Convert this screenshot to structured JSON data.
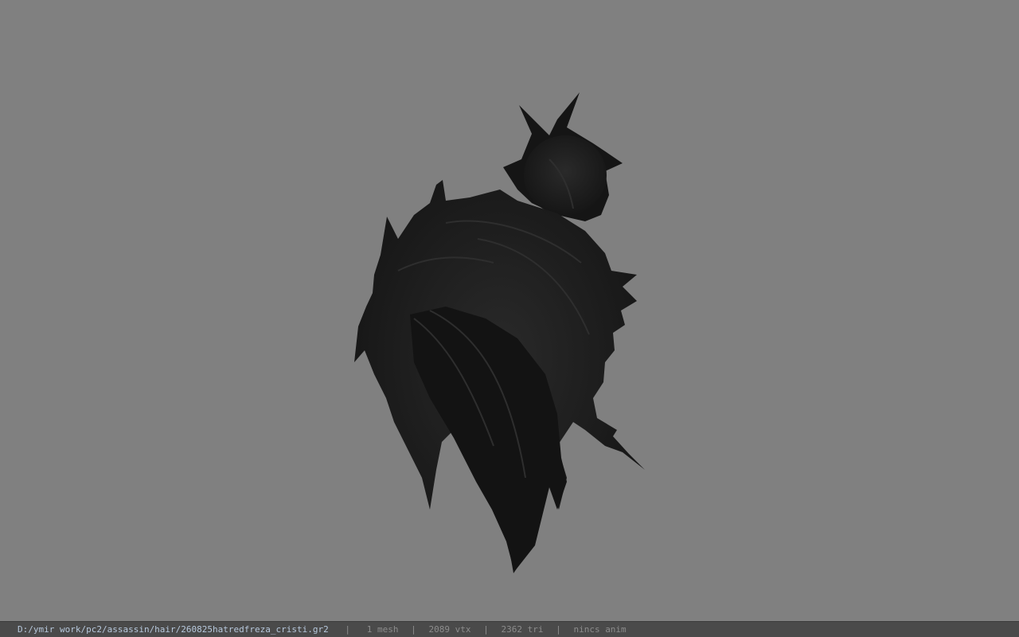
{
  "viewer": {
    "background_color": "#808080",
    "model_color": "#1f1f1f",
    "model_icon": "hair-mesh-silhouette"
  },
  "statusbar": {
    "file_path": "D:/ymir work/pc2/assassin/hair/260825hatredfreza_cristi.gr2",
    "separator": "|",
    "mesh_count": "1 mesh",
    "vertex_count": "2089 vtx",
    "triangle_count": "2362 tri",
    "anim_status": "nincs anim"
  }
}
